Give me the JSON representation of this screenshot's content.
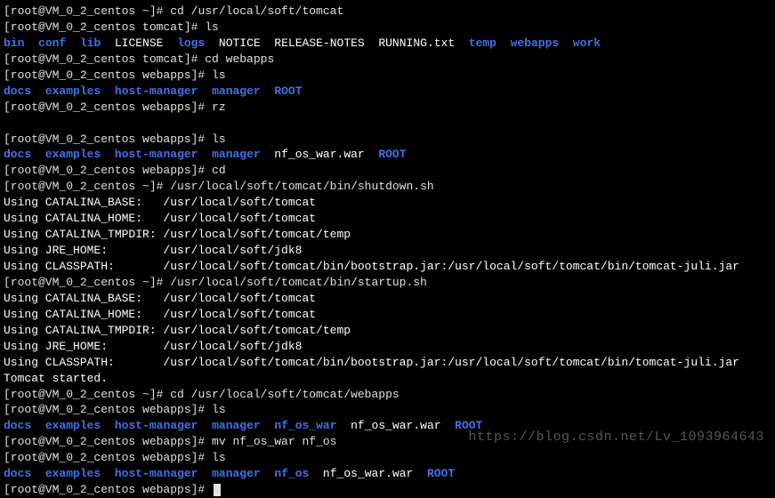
{
  "lines": [
    {
      "segments": [
        {
          "text": "[root@VM_0_2_centos ~]# ",
          "cls": "prompt"
        },
        {
          "text": "cd /usr/local/soft/tomcat",
          "cls": "cmd"
        }
      ]
    },
    {
      "segments": [
        {
          "text": "[root@VM_0_2_centos tomcat]# ",
          "cls": "prompt"
        },
        {
          "text": "ls",
          "cls": "cmd"
        }
      ]
    },
    {
      "segments": [
        {
          "text": "bin",
          "cls": "blue"
        },
        {
          "text": "  ",
          "cls": ""
        },
        {
          "text": "conf",
          "cls": "blue"
        },
        {
          "text": "  ",
          "cls": ""
        },
        {
          "text": "lib",
          "cls": "blue"
        },
        {
          "text": "  LICENSE  ",
          "cls": "white"
        },
        {
          "text": "logs",
          "cls": "blue"
        },
        {
          "text": "  NOTICE  RELEASE-NOTES  RUNNING.txt  ",
          "cls": "white"
        },
        {
          "text": "temp",
          "cls": "blue"
        },
        {
          "text": "  ",
          "cls": ""
        },
        {
          "text": "webapps",
          "cls": "blue"
        },
        {
          "text": "  ",
          "cls": ""
        },
        {
          "text": "work",
          "cls": "blue"
        }
      ]
    },
    {
      "segments": [
        {
          "text": "[root@VM_0_2_centos tomcat]# ",
          "cls": "prompt"
        },
        {
          "text": "cd webapps",
          "cls": "cmd"
        }
      ]
    },
    {
      "segments": [
        {
          "text": "[root@VM_0_2_centos webapps]# ",
          "cls": "prompt"
        },
        {
          "text": "ls",
          "cls": "cmd"
        }
      ]
    },
    {
      "segments": [
        {
          "text": "docs",
          "cls": "blue"
        },
        {
          "text": "  ",
          "cls": ""
        },
        {
          "text": "examples",
          "cls": "blue"
        },
        {
          "text": "  ",
          "cls": ""
        },
        {
          "text": "host-manager",
          "cls": "blue"
        },
        {
          "text": "  ",
          "cls": ""
        },
        {
          "text": "manager",
          "cls": "blue"
        },
        {
          "text": "  ",
          "cls": ""
        },
        {
          "text": "ROOT",
          "cls": "blue"
        }
      ]
    },
    {
      "segments": [
        {
          "text": "[root@VM_0_2_centos webapps]# ",
          "cls": "prompt"
        },
        {
          "text": "rz",
          "cls": "cmd"
        }
      ]
    },
    {
      "segments": [
        {
          "text": " ",
          "cls": ""
        }
      ]
    },
    {
      "segments": [
        {
          "text": "[root@VM_0_2_centos webapps]# ",
          "cls": "prompt"
        },
        {
          "text": "ls",
          "cls": "cmd"
        }
      ]
    },
    {
      "segments": [
        {
          "text": "docs",
          "cls": "blue"
        },
        {
          "text": "  ",
          "cls": ""
        },
        {
          "text": "examples",
          "cls": "blue"
        },
        {
          "text": "  ",
          "cls": ""
        },
        {
          "text": "host-manager",
          "cls": "blue"
        },
        {
          "text": "  ",
          "cls": ""
        },
        {
          "text": "manager",
          "cls": "blue"
        },
        {
          "text": "  nf_os_war.war  ",
          "cls": "white"
        },
        {
          "text": "ROOT",
          "cls": "blue"
        }
      ]
    },
    {
      "segments": [
        {
          "text": "[root@VM_0_2_centos webapps]# ",
          "cls": "prompt"
        },
        {
          "text": "cd",
          "cls": "cmd"
        }
      ]
    },
    {
      "segments": [
        {
          "text": "[root@VM_0_2_centos ~]# ",
          "cls": "prompt"
        },
        {
          "text": "/usr/local/soft/tomcat/bin/shutdown.sh",
          "cls": "cmd"
        }
      ]
    },
    {
      "segments": [
        {
          "text": "Using CATALINA_BASE:   /usr/local/soft/tomcat",
          "cls": "white"
        }
      ]
    },
    {
      "segments": [
        {
          "text": "Using CATALINA_HOME:   /usr/local/soft/tomcat",
          "cls": "white"
        }
      ]
    },
    {
      "segments": [
        {
          "text": "Using CATALINA_TMPDIR: /usr/local/soft/tomcat/temp",
          "cls": "white"
        }
      ]
    },
    {
      "segments": [
        {
          "text": "Using JRE_HOME:        /usr/local/soft/jdk8",
          "cls": "white"
        }
      ]
    },
    {
      "segments": [
        {
          "text": "Using CLASSPATH:       /usr/local/soft/tomcat/bin/bootstrap.jar:/usr/local/soft/tomcat/bin/tomcat-juli.jar",
          "cls": "white"
        }
      ]
    },
    {
      "segments": [
        {
          "text": "[root@VM_0_2_centos ~]# ",
          "cls": "prompt"
        },
        {
          "text": "/usr/local/soft/tomcat/bin/startup.sh",
          "cls": "cmd"
        }
      ]
    },
    {
      "segments": [
        {
          "text": "Using CATALINA_BASE:   /usr/local/soft/tomcat",
          "cls": "white"
        }
      ]
    },
    {
      "segments": [
        {
          "text": "Using CATALINA_HOME:   /usr/local/soft/tomcat",
          "cls": "white"
        }
      ]
    },
    {
      "segments": [
        {
          "text": "Using CATALINA_TMPDIR: /usr/local/soft/tomcat/temp",
          "cls": "white"
        }
      ]
    },
    {
      "segments": [
        {
          "text": "Using JRE_HOME:        /usr/local/soft/jdk8",
          "cls": "white"
        }
      ]
    },
    {
      "segments": [
        {
          "text": "Using CLASSPATH:       /usr/local/soft/tomcat/bin/bootstrap.jar:/usr/local/soft/tomcat/bin/tomcat-juli.jar",
          "cls": "white"
        }
      ]
    },
    {
      "segments": [
        {
          "text": "Tomcat started.",
          "cls": "white"
        }
      ]
    },
    {
      "segments": [
        {
          "text": "[root@VM_0_2_centos ~]# ",
          "cls": "prompt"
        },
        {
          "text": "cd /usr/local/soft/tomcat/webapps",
          "cls": "cmd"
        }
      ]
    },
    {
      "segments": [
        {
          "text": "[root@VM_0_2_centos webapps]# ",
          "cls": "prompt"
        },
        {
          "text": "ls",
          "cls": "cmd"
        }
      ]
    },
    {
      "segments": [
        {
          "text": "docs",
          "cls": "blue"
        },
        {
          "text": "  ",
          "cls": ""
        },
        {
          "text": "examples",
          "cls": "blue"
        },
        {
          "text": "  ",
          "cls": ""
        },
        {
          "text": "host-manager",
          "cls": "blue"
        },
        {
          "text": "  ",
          "cls": ""
        },
        {
          "text": "manager",
          "cls": "blue"
        },
        {
          "text": "  ",
          "cls": ""
        },
        {
          "text": "nf_os_war",
          "cls": "blue"
        },
        {
          "text": "  nf_os_war.war  ",
          "cls": "white"
        },
        {
          "text": "ROOT",
          "cls": "blue"
        }
      ]
    },
    {
      "segments": [
        {
          "text": "[root@VM_0_2_centos webapps]# ",
          "cls": "prompt"
        },
        {
          "text": "mv nf_os_war nf_os",
          "cls": "cmd"
        }
      ]
    },
    {
      "segments": [
        {
          "text": "[root@VM_0_2_centos webapps]# ",
          "cls": "prompt"
        },
        {
          "text": "ls",
          "cls": "cmd"
        }
      ]
    },
    {
      "segments": [
        {
          "text": "docs",
          "cls": "blue"
        },
        {
          "text": "  ",
          "cls": ""
        },
        {
          "text": "examples",
          "cls": "blue"
        },
        {
          "text": "  ",
          "cls": ""
        },
        {
          "text": "host-manager",
          "cls": "blue"
        },
        {
          "text": "  ",
          "cls": ""
        },
        {
          "text": "manager",
          "cls": "blue"
        },
        {
          "text": "  ",
          "cls": ""
        },
        {
          "text": "nf_os",
          "cls": "blue"
        },
        {
          "text": "  nf_os_war.war  ",
          "cls": "white"
        },
        {
          "text": "ROOT",
          "cls": "blue"
        }
      ]
    },
    {
      "segments": [
        {
          "text": "[root@VM_0_2_centos webapps]# ",
          "cls": "prompt"
        }
      ],
      "cursor": true
    }
  ],
  "watermark": "https://blog.csdn.net/Lv_1093964643"
}
